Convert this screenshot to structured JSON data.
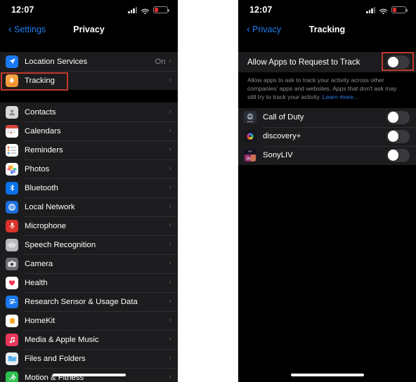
{
  "left_phone": {
    "status_bar": {
      "time": "12:07",
      "cellular": "cellular-bars-icon",
      "wifi": "wifi-icon",
      "battery": "battery-low-icon"
    },
    "nav": {
      "back_label": "Settings",
      "title": "Privacy"
    },
    "group_1": [
      {
        "label": "Location Services",
        "icon": "location-arrow-icon",
        "value": "On",
        "chevron": "›"
      },
      {
        "label": "Tracking",
        "icon": "tracking-hand-icon",
        "value": "",
        "chevron": "›",
        "highlighted": true
      }
    ],
    "group_2": [
      {
        "label": "Contacts",
        "icon": "contacts-icon",
        "chevron": "›"
      },
      {
        "label": "Calendars",
        "icon": "calendar-icon",
        "chevron": "›"
      },
      {
        "label": "Reminders",
        "icon": "reminders-icon",
        "chevron": "›"
      },
      {
        "label": "Photos",
        "icon": "photos-icon",
        "chevron": "›"
      },
      {
        "label": "Bluetooth",
        "icon": "bluetooth-icon",
        "chevron": "›"
      },
      {
        "label": "Local Network",
        "icon": "local-network-globe-icon",
        "chevron": "›"
      },
      {
        "label": "Microphone",
        "icon": "microphone-icon",
        "chevron": "›"
      },
      {
        "label": "Speech Recognition",
        "icon": "waveform-icon",
        "chevron": "›"
      },
      {
        "label": "Camera",
        "icon": "camera-icon",
        "chevron": "›"
      },
      {
        "label": "Health",
        "icon": "heart-icon",
        "chevron": "›"
      },
      {
        "label": "Research Sensor & Usage Data",
        "icon": "research-icon",
        "chevron": "›"
      },
      {
        "label": "HomeKit",
        "icon": "home-icon",
        "chevron": "›"
      },
      {
        "label": "Media & Apple Music",
        "icon": "music-note-icon",
        "chevron": "›"
      },
      {
        "label": "Files and Folders",
        "icon": "folder-icon",
        "chevron": "›"
      },
      {
        "label": "Motion & Fitness",
        "icon": "running-person-icon",
        "chevron": "›"
      }
    ],
    "home_indicator": "home-indicator"
  },
  "right_phone": {
    "status_bar": {
      "time": "12:07",
      "cellular": "cellular-bars-icon",
      "wifi": "wifi-icon",
      "battery": "battery-low-icon"
    },
    "nav": {
      "back_label": "Privacy",
      "title": "Tracking"
    },
    "master_toggle": {
      "label": "Allow Apps to Request to Track",
      "state": "off",
      "highlighted": true
    },
    "footer": {
      "text": "Allow apps to ask to track your activity across other companies' apps and websites. Apps that don't ask may still try to track your activity. ",
      "link": "Learn more…"
    },
    "apps": [
      {
        "label": "Call of Duty",
        "icon": "call-of-duty-app-icon",
        "state": "off"
      },
      {
        "label": "discovery+",
        "icon": "discovery-plus-app-icon",
        "state": "off"
      },
      {
        "label": "SonyLIV",
        "icon": "sonyliv-app-icon",
        "state": "off"
      }
    ],
    "home_indicator": "home-indicator"
  },
  "colors": {
    "accent_blue": "#1f7df0",
    "highlight_red": "#c0392b",
    "row_background": "#1c1c1e",
    "secondary_text": "#8e8e93",
    "battery_red": "#e02b2b"
  }
}
